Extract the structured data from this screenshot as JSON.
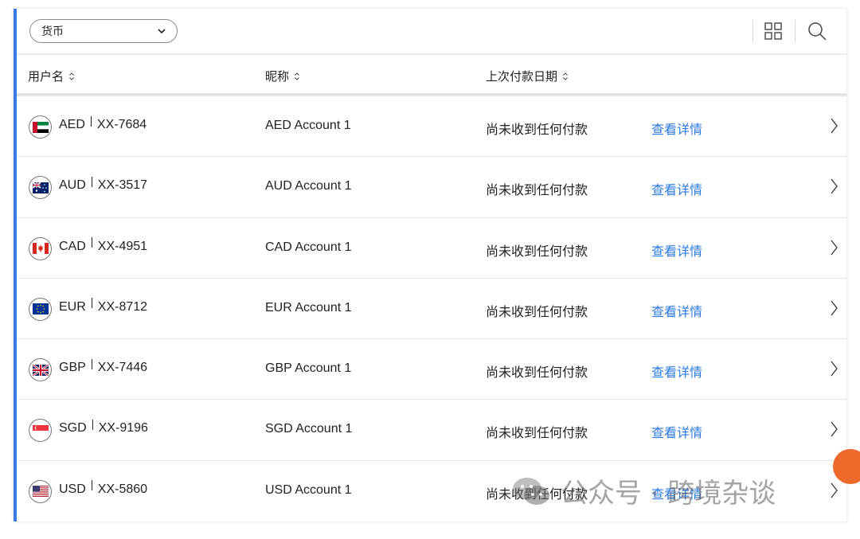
{
  "filter": {
    "currency_label": "货币"
  },
  "columns": {
    "username": "用户名",
    "nickname": "昵称",
    "last_payment_date": "上次付款日期"
  },
  "rows": [
    {
      "code": "AED",
      "masked_account": "XX-7684",
      "nickname": "AED Account 1",
      "last_payment": "尚未收到任何付款",
      "action": "查看详情",
      "flag_icon": "uae-flag-icon"
    },
    {
      "code": "AUD",
      "masked_account": "XX-3517",
      "nickname": "AUD Account 1",
      "last_payment": "尚未收到任何付款",
      "action": "查看详情",
      "flag_icon": "australia-flag-icon"
    },
    {
      "code": "CAD",
      "masked_account": "XX-4951",
      "nickname": "CAD Account 1",
      "last_payment": "尚未收到任何付款",
      "action": "查看详情",
      "flag_icon": "canada-flag-icon"
    },
    {
      "code": "EUR",
      "masked_account": "XX-8712",
      "nickname": "EUR Account 1",
      "last_payment": "尚未收到任何付款",
      "action": "查看详情",
      "flag_icon": "eu-flag-icon"
    },
    {
      "code": "GBP",
      "masked_account": "XX-7446",
      "nickname": "GBP Account 1",
      "last_payment": "尚未收到任何付款",
      "action": "查看详情",
      "flag_icon": "uk-flag-icon"
    },
    {
      "code": "SGD",
      "masked_account": "XX-9196",
      "nickname": "SGD Account 1",
      "last_payment": "尚未收到任何付款",
      "action": "查看详情",
      "flag_icon": "singapore-flag-icon"
    },
    {
      "code": "USD",
      "masked_account": "XX-5860",
      "nickname": "USD Account 1",
      "last_payment": "尚未收到任何付款",
      "action": "查看详情",
      "flag_icon": "usa-flag-icon"
    }
  ],
  "watermark": {
    "text": "公众号 · 跨境杂谈"
  },
  "colors": {
    "accent": "#3b78e7",
    "link": "#2a7ae2",
    "fab": "#ee6a2c"
  }
}
